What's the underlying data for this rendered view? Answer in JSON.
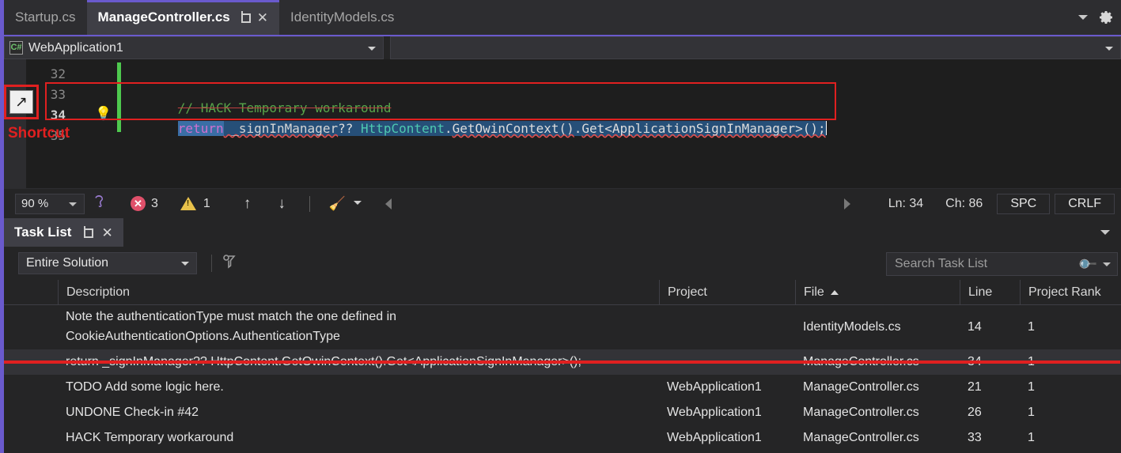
{
  "window": {
    "tabs": [
      {
        "label": "Startup.cs",
        "active": false
      },
      {
        "label": "ManageController.cs",
        "active": true
      },
      {
        "label": "IdentityModels.cs",
        "active": false
      }
    ],
    "pin_icon": "pin-icon",
    "close_icon": "close-icon",
    "chevron_icon": "chevron-down-icon",
    "gear_icon": "gear-icon"
  },
  "navbar": {
    "project_icon": "csharp-file-icon",
    "project_icon_text": "C#",
    "project": "WebApplication1",
    "member": ""
  },
  "editor": {
    "lines": [
      {
        "number": "32",
        "text": ""
      },
      {
        "number": "33",
        "text": "// HACK Temporary workaround"
      },
      {
        "number": "34",
        "text": "return _signInManager?? HttpContent.GetOwinContext().Get<ApplicationSignInManager>();"
      },
      {
        "number": "35",
        "text": ""
      }
    ],
    "current_line": "34",
    "code": {
      "comment": "// HACK Temporary workaround",
      "keyword": "return",
      "field": " _signInManager",
      "operator": "?? ",
      "type": "HttpContent",
      "dot1": ".",
      "method1": "GetOwinContext()",
      "dot2": ".",
      "method2": "Get<ApplicationSignInManager>();"
    },
    "lightbulb_icon": "lightbulb-icon"
  },
  "annotation": {
    "label": "Shortcut",
    "icon": "shortcut-arrow-icon",
    "icon_glyph": "↗",
    "color": "#e02020"
  },
  "statusbar": {
    "zoom": "90 %",
    "hearing_icon": "accessibility-icon",
    "error_icon": "error-icon",
    "error_count": "3",
    "warning_icon": "warning-icon",
    "warning_count": "1",
    "prev_icon": "arrow-up-icon",
    "prev_glyph": "↑",
    "next_icon": "arrow-down-icon",
    "next_glyph": "↓",
    "cleanup_icon": "code-cleanup-broom-icon",
    "cleanup_glyph": "🧹",
    "scroll_left_icon": "scroll-left-icon",
    "scroll_right_icon": "scroll-right-icon",
    "line": "Ln: 34",
    "column": "Ch: 86",
    "spaces": "SPC",
    "line_endings": "CRLF"
  },
  "tasklist": {
    "title": "Task List",
    "pin_icon": "pin-icon",
    "close_icon": "close-icon",
    "collapse_icon": "chevron-down-icon",
    "scope": "Entire Solution",
    "filter_icon": "filter-icon",
    "search": {
      "placeholder": "Search Task List",
      "icon": "search-icon",
      "dropdown_icon": "chevron-down-icon"
    },
    "columns": [
      {
        "key": "icon",
        "label": ""
      },
      {
        "key": "description",
        "label": "Description"
      },
      {
        "key": "project",
        "label": "Project"
      },
      {
        "key": "file",
        "label": "File",
        "sorted": "asc"
      },
      {
        "key": "line",
        "label": "Line"
      },
      {
        "key": "rank",
        "label": "Project Rank"
      }
    ],
    "rows": [
      {
        "description": "Note the authenticationType must match the one defined in CookieAuthenticationOptions.AuthenticationType",
        "description_lines": [
          "Note the authenticationType must match the one defined in",
          "CookieAuthenticationOptions.AuthenticationType"
        ],
        "project": "",
        "file": "IdentityModels.cs",
        "line": "14",
        "rank": "1",
        "selected": false,
        "annotated": false
      },
      {
        "description": "return _signInManager?? HttpContent.GetOwinContext().Get<ApplicationSignInManager>();",
        "description_lines": [
          "return _signInManager?? HttpContent.GetOwinContext().Get<ApplicationSignInManager>();"
        ],
        "project": "",
        "file": "ManageController.cs",
        "line": "34",
        "rank": "1",
        "selected": true,
        "annotated": true
      },
      {
        "description": "TODO Add some logic here.",
        "description_lines": [
          "TODO Add some logic here."
        ],
        "project": "WebApplication1",
        "file": "ManageController.cs",
        "line": "21",
        "rank": "1",
        "selected": false,
        "annotated": false
      },
      {
        "description": "UNDONE Check-in #42",
        "description_lines": [
          "UNDONE Check-in #42"
        ],
        "project": "WebApplication1",
        "file": "ManageController.cs",
        "line": "26",
        "rank": "1",
        "selected": false,
        "annotated": false
      },
      {
        "description": "HACK Temporary workaround",
        "description_lines": [
          "HACK Temporary workaround"
        ],
        "project": "WebApplication1",
        "file": "ManageController.cs",
        "line": "33",
        "rank": "1",
        "selected": false,
        "annotated": false
      }
    ]
  },
  "colors": {
    "accent": "#6a5acd",
    "annotation": "#e02020",
    "error": "#e0506a",
    "warning": "#e8c14a",
    "changebar": "#4ec94e",
    "comment": "#57a64a",
    "keyword": "#d070d0",
    "type": "#4ec9b0",
    "selection": "#264f78"
  }
}
